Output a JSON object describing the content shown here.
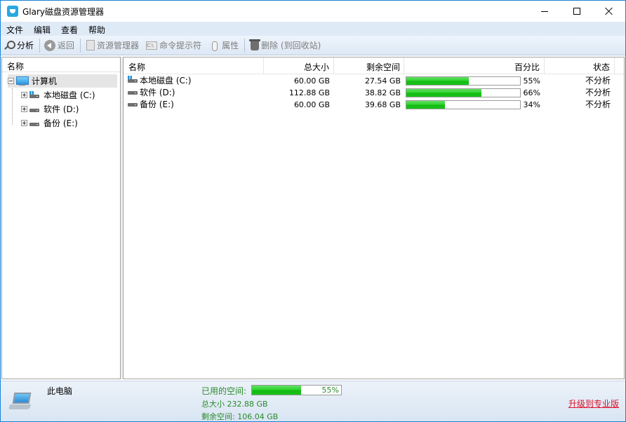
{
  "window": {
    "title": "Glary磁盘资源管理器"
  },
  "menu": [
    "文件",
    "编辑",
    "查看",
    "帮助"
  ],
  "toolbar": {
    "analyze": "分析",
    "back": "返回",
    "explorer": "资源管理器",
    "cmd": "命令提示符",
    "cmd_icon_text": "C:\\",
    "properties": "属性",
    "delete": "删除 (到回收站)"
  },
  "tree": {
    "header": "名称",
    "root": "计算机",
    "drives": [
      {
        "label": "本地磁盘 (C:)",
        "icon": "windows-drive-icon"
      },
      {
        "label": "软件 (D:)",
        "icon": "drive-icon"
      },
      {
        "label": "备份 (E:)",
        "icon": "drive-icon"
      }
    ]
  },
  "list": {
    "columns": {
      "name": "名称",
      "total": "总大小",
      "free": "剩余空间",
      "percent": "百分比",
      "status": "状态"
    },
    "rows": [
      {
        "name": "本地磁盘 (C:)",
        "total": "60.00 GB",
        "free": "27.54 GB",
        "percent_text": "55%",
        "percent": 55,
        "status": "不分析"
      },
      {
        "name": "软件 (D:)",
        "total": "112.88 GB",
        "free": "38.82 GB",
        "percent_text": "66%",
        "percent": 66,
        "status": "不分析"
      },
      {
        "name": "备份 (E:)",
        "total": "60.00 GB",
        "free": "39.68 GB",
        "percent_text": "34%",
        "percent": 34,
        "status": "不分析"
      }
    ]
  },
  "statusbar": {
    "pc_label": "此电脑",
    "used_label": "已用的空间:",
    "used_percent_text": "55%",
    "used_percent": 55,
    "total": "总大小 232.88 GB",
    "free": "剩余空间: 106.04 GB",
    "upgrade": "升级到专业版"
  },
  "colors": {
    "accent_green": "#19c219",
    "upgrade_red": "#e0102a",
    "window_border": "#1883d7"
  }
}
